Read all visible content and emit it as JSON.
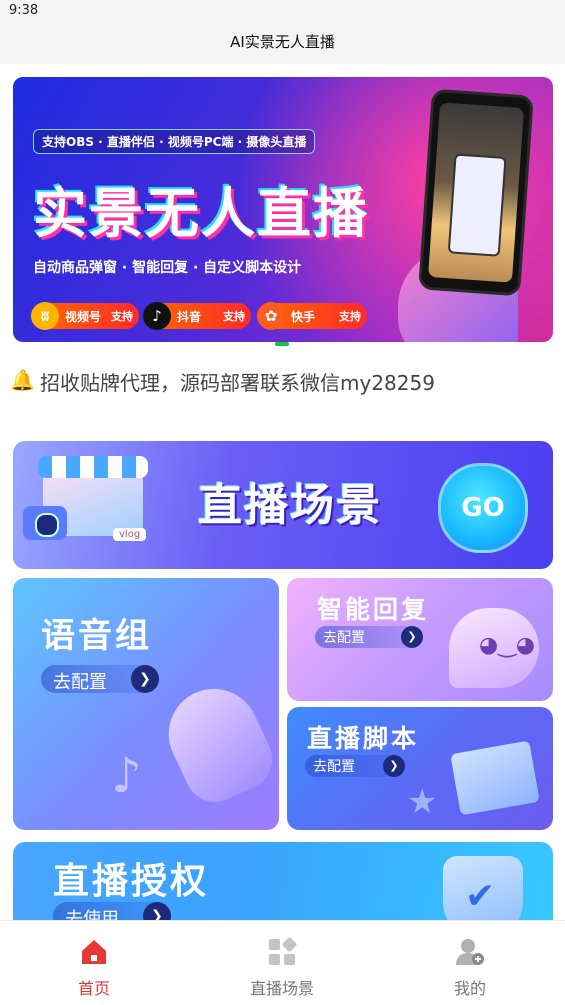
{
  "status_bar": {
    "time": "9:38"
  },
  "header": {
    "title": "AI实景无人直播"
  },
  "banner": {
    "tagline": "支持OBS · 直播伴侣 · 视频号PC端 · 摄像头直播",
    "title": "实景无人直播",
    "features": "自动商品弹窗 · 智能回复 · 自定义脚本设计",
    "platforms": [
      {
        "name": "视频号",
        "support": "支持",
        "icon": "wechat-channels-icon"
      },
      {
        "name": "抖音",
        "support": "支持",
        "icon": "douyin-icon"
      },
      {
        "name": "快手",
        "support": "支持",
        "icon": "kuaishou-icon"
      }
    ]
  },
  "notice": {
    "icon": "bell-icon",
    "text": "招收贴牌代理，源码部署联系微信my28259"
  },
  "cards": {
    "live_scene": {
      "title": "直播场景",
      "go": "GO"
    },
    "voice_group": {
      "title": "语音组",
      "action": "去配置"
    },
    "smart_reply": {
      "title": "智能回复",
      "action": "去配置"
    },
    "live_script": {
      "title": "直播脚本",
      "action": "去配置"
    },
    "live_auth": {
      "title": "直播授权",
      "action": "去使用"
    }
  },
  "tabbar": {
    "items": [
      {
        "label": "首页",
        "icon": "home-icon",
        "active": true
      },
      {
        "label": "直播场景",
        "icon": "grid-icon",
        "active": false
      },
      {
        "label": "我的",
        "icon": "user-icon",
        "active": false
      }
    ],
    "active_color": "#e53935",
    "inactive_color": "#777777"
  }
}
